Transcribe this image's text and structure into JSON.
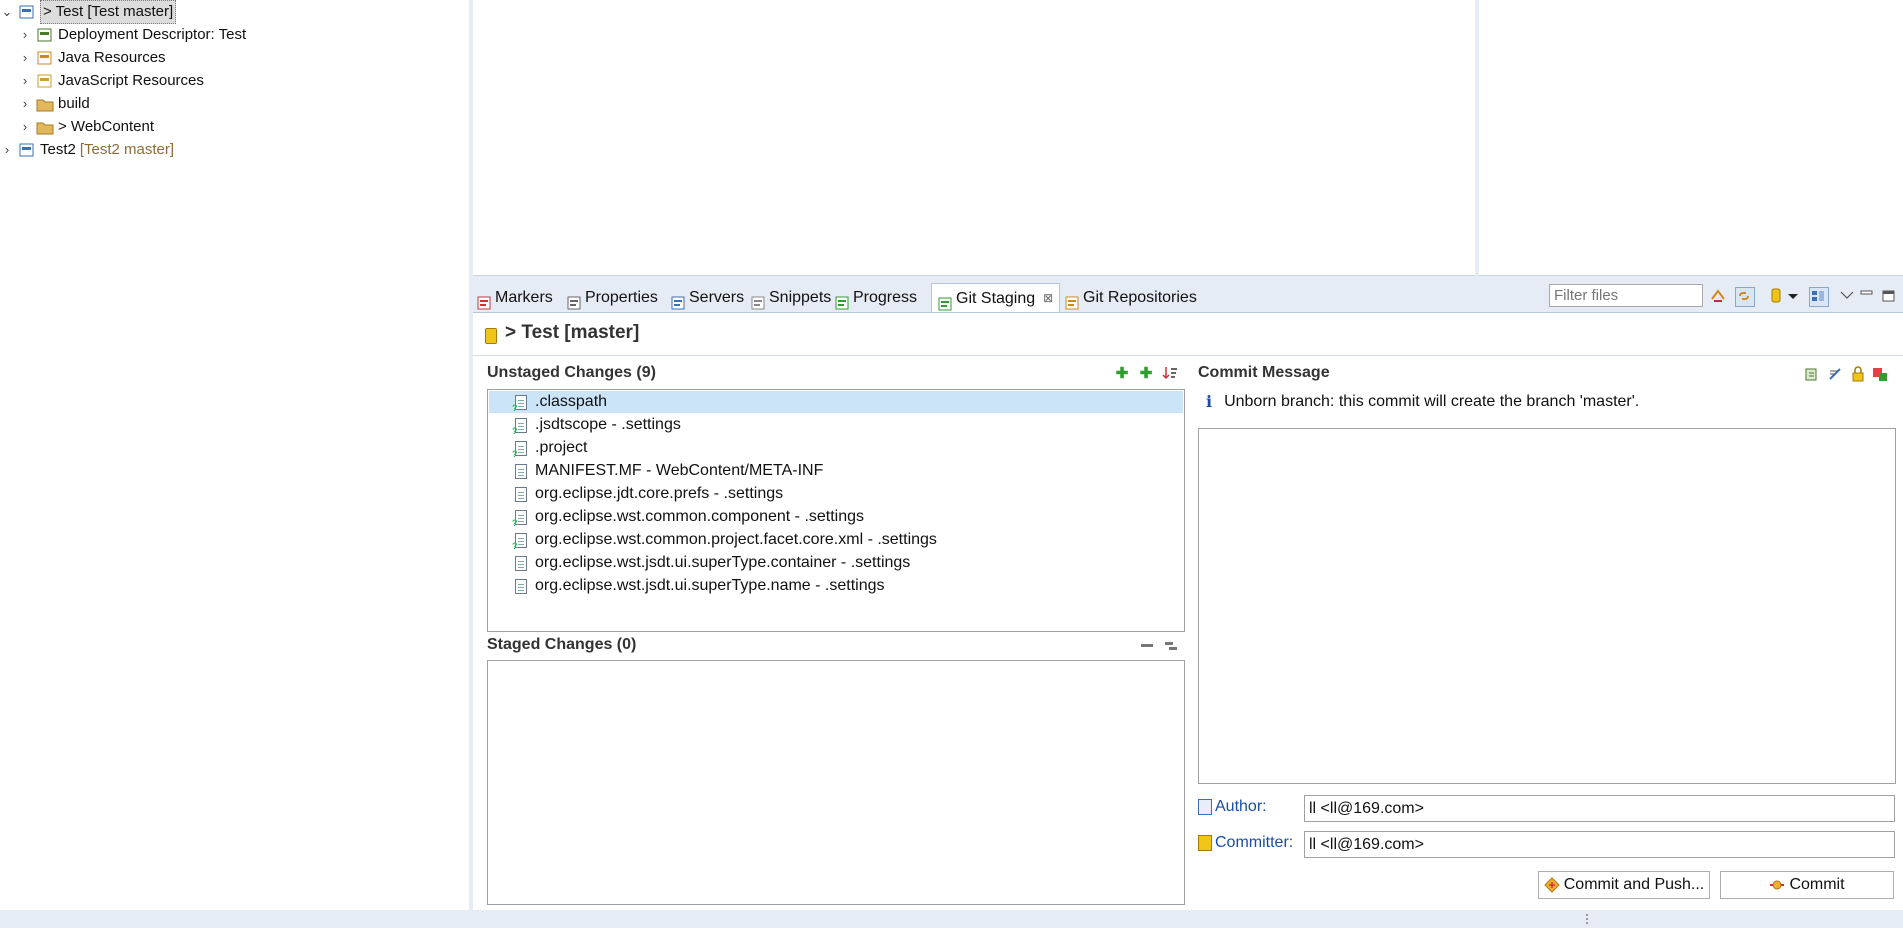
{
  "tree": {
    "items": [
      {
        "label": "> Test [Test master]",
        "decoration": "",
        "expanded": true,
        "selected": true,
        "depth": 0,
        "icon": "project-icon"
      },
      {
        "label": "Deployment Descriptor: Test",
        "decoration": "",
        "depth": 1,
        "icon": "descriptor-icon"
      },
      {
        "label": "Java Resources",
        "decoration": "",
        "depth": 1,
        "icon": "java-resources-icon"
      },
      {
        "label": "JavaScript Resources",
        "decoration": "",
        "depth": 1,
        "icon": "javascript-resources-icon"
      },
      {
        "label": "build",
        "decoration": "",
        "depth": 1,
        "icon": "folder-icon"
      },
      {
        "label": "> WebContent",
        "decoration": "",
        "depth": 1,
        "icon": "folder-icon"
      },
      {
        "label": "Test2",
        "decoration": "[Test2 master]",
        "depth": 0,
        "icon": "project-icon"
      }
    ]
  },
  "tabs": [
    {
      "label": "Markers",
      "icon": "markers-icon"
    },
    {
      "label": "Properties",
      "icon": "properties-icon"
    },
    {
      "label": "Servers",
      "icon": "servers-icon"
    },
    {
      "label": "Snippets",
      "icon": "snippets-icon"
    },
    {
      "label": "Progress",
      "icon": "progress-icon"
    },
    {
      "label": "Git Staging",
      "icon": "git-staging-icon",
      "active": true
    },
    {
      "label": "Git Repositories",
      "icon": "git-repositories-icon"
    }
  ],
  "toolbar": {
    "filter_placeholder": "Filter files"
  },
  "staging": {
    "repo_title": "> Test [master]",
    "unstaged_title": "Unstaged Changes (9)",
    "unstaged": [
      {
        "name": ".classpath",
        "selected": true
      },
      {
        "name": ".jsdtscope - .settings"
      },
      {
        "name": ".project"
      },
      {
        "name": "MANIFEST.MF - WebContent/META-INF"
      },
      {
        "name": "org.eclipse.jdt.core.prefs - .settings"
      },
      {
        "name": "org.eclipse.wst.common.component - .settings"
      },
      {
        "name": "org.eclipse.wst.common.project.facet.core.xml - .settings"
      },
      {
        "name": "org.eclipse.wst.jsdt.ui.superType.container - .settings"
      },
      {
        "name": "org.eclipse.wst.jsdt.ui.superType.name - .settings"
      }
    ],
    "staged_title": "Staged Changes (0)",
    "commit_title": "Commit Message",
    "info": "Unborn branch: this commit will create the branch 'master'.",
    "message": "",
    "author_label": "Author:",
    "author_value": "ll <ll@169.com>",
    "committer_label": "Committer:",
    "committer_value": "ll <ll@169.com>",
    "commit_push_label": "Commit and Push...",
    "commit_label": "Commit"
  },
  "colors": {
    "accent": "#1a4ea6",
    "selection": "#cce4f7",
    "decoration": "#8b6d3a",
    "add": "#2e9e2e"
  }
}
